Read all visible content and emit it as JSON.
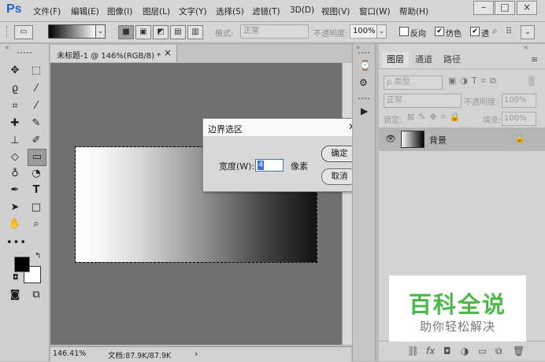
{
  "app": {
    "logo": "Ps",
    "menu": [
      "文件(F)",
      "编辑(E)",
      "图像(I)",
      "图层(L)",
      "文字(Y)",
      "选择(S)",
      "滤镜(T)",
      "3D(D)",
      "视图(V)",
      "窗口(W)",
      "帮助(H)"
    ],
    "window_controls": [
      "–",
      "□",
      "×"
    ]
  },
  "options_bar": {
    "mode_label": "模式:",
    "mode_value": "正常",
    "opacity_label": "不透明度:",
    "opacity_value": "100%",
    "reverse_label": "反向",
    "dither_label": "仿色",
    "transparency_label": "透"
  },
  "document": {
    "tab_title": "未标题-1 @ 146%(RGB/8) *",
    "tab_close": "×",
    "zoom": "146.41%",
    "doc_info": "文档:87.9K/87.9K",
    "status_arrow": "›"
  },
  "dialog": {
    "title": "边界选区",
    "close": "✕",
    "width_label": "宽度(W):",
    "width_value": "4",
    "unit": "像素",
    "ok": "确定",
    "cancel": "取消"
  },
  "layers_panel": {
    "tabs": [
      "图层",
      "通道",
      "路径"
    ],
    "kind_filter": "ρ 类型",
    "blend_mode": "正常",
    "opacity_label": "不透明度:",
    "opacity_value": "100%",
    "lock_label": "锁定:",
    "fill_label": "填充:",
    "fill_value": "100%",
    "layers": [
      {
        "name": "背景"
      }
    ]
  },
  "watermark": {
    "title": "百科全说",
    "subtitle": "助你轻松解决"
  },
  "colors": {
    "logo_blue": "#1f64c8",
    "watermark_green": "#4cb848",
    "canvas_bg": "#707070"
  }
}
